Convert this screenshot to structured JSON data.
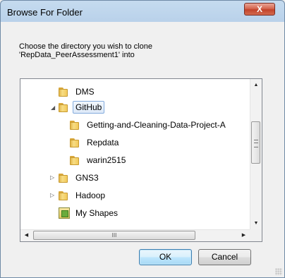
{
  "window": {
    "title": "Browse For Folder",
    "close_label": "X"
  },
  "instruction": {
    "line1": "Choose the directory you wish to clone",
    "line2": "'RepData_PeerAssessment1' into"
  },
  "tree": {
    "selected": "GitHub",
    "items": [
      {
        "label": "DMS",
        "icon": "folder-icon",
        "expander": ""
      },
      {
        "label": "GitHub",
        "icon": "folder-icon",
        "expander": "◢"
      },
      {
        "label": "Getting-and-Cleaning-Data-Project-A",
        "icon": "folder-icon",
        "expander": ""
      },
      {
        "label": "Repdata",
        "icon": "folder-icon",
        "expander": ""
      },
      {
        "label": "warin2515",
        "icon": "folder-icon",
        "expander": ""
      },
      {
        "label": "GNS3",
        "icon": "folder-icon",
        "expander": "▷"
      },
      {
        "label": "Hadoop",
        "icon": "folder-icon",
        "expander": "▷"
      },
      {
        "label": "My Shapes",
        "icon": "shapes-icon",
        "expander": ""
      }
    ]
  },
  "scrollbars": {
    "up": "▲",
    "down": "▼",
    "left": "◀",
    "right": "▶",
    "hthumb_grip": "III"
  },
  "buttons": {
    "ok_label": "OK",
    "cancel_label": "Cancel"
  }
}
